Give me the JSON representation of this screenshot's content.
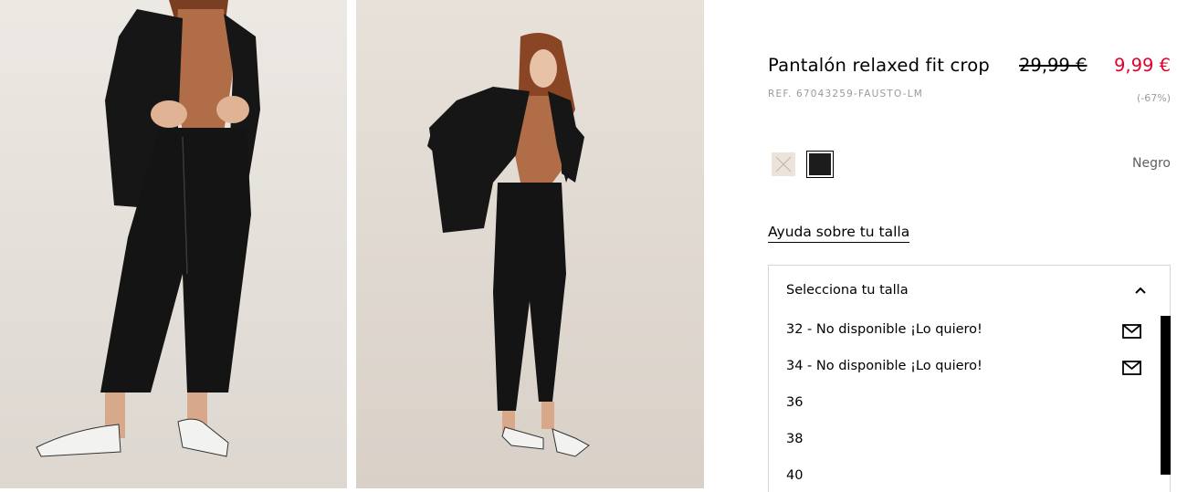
{
  "product": {
    "title": "Pantalón relaxed fit crop",
    "old_price": "29,99 €",
    "new_price": "9,99 €",
    "reference": "REF. 67043259-FAUSTO-LM",
    "discount": "(-67%)"
  },
  "colors": {
    "selected_name": "Negro",
    "swatches": [
      {
        "name": "beige",
        "hex": "#ece4db",
        "available": false
      },
      {
        "name": "negro",
        "hex": "#1c1c1c",
        "available": true,
        "selected": true
      }
    ],
    "price_color": "#e3002b"
  },
  "size_help": {
    "label": "Ayuda sobre tu talla"
  },
  "size_selector": {
    "placeholder": "Selecciona tu talla",
    "expanded": true,
    "options": [
      {
        "label": "32 - No disponible ¡Lo quiero!",
        "icon": "mail-icon"
      },
      {
        "label": "34 - No disponible ¡Lo quiero!",
        "icon": "mail-icon"
      },
      {
        "label": "36"
      },
      {
        "label": "38"
      },
      {
        "label": "40"
      }
    ]
  },
  "images": [
    {
      "alt": "product-photo-front"
    },
    {
      "alt": "product-photo-side"
    }
  ]
}
